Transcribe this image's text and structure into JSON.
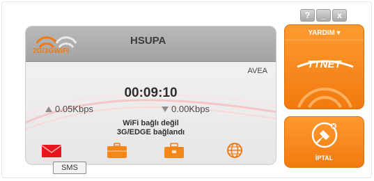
{
  "window": {
    "help_btn": "?",
    "minimize_btn": "_",
    "close_btn": "x"
  },
  "connection": {
    "brand": "2G/3GWiFi",
    "network_type": "HSUPA",
    "operator": "AVEA",
    "timer": "00:09:10",
    "upload_speed": "0.05Kbps",
    "download_speed": "0.00Kbps",
    "wifi_status": "WiFi bağlı değil",
    "mobile_status": "3G/EDGE bağlandı"
  },
  "toolbar": {
    "tooltip": "SMS",
    "icons": [
      "envelope-icon",
      "briefcase-icon",
      "toolbox-icon",
      "globe-icon"
    ]
  },
  "side": {
    "help_label": "YARDIM ▾",
    "logo_text": "TTNET",
    "cancel_label": "İPTAL"
  },
  "colors": {
    "accent_orange": "#f58618",
    "panel_grey": "#ebebeb",
    "icon_red": "#e8161f"
  }
}
